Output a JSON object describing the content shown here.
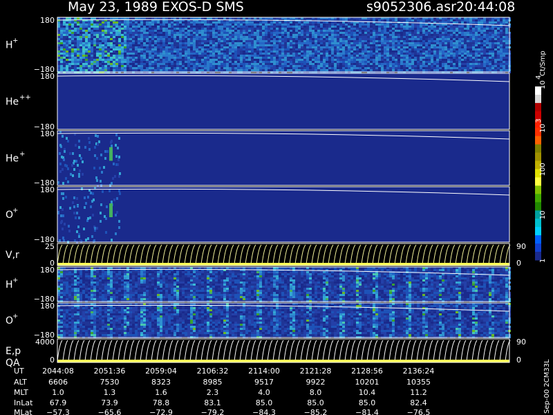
{
  "header": {
    "title": "May 23, 1989   EXOS-D SMS",
    "file": "s9052306.asr",
    "time": "20:44:08"
  },
  "side": {
    "cbar_label": "Ct/Smp",
    "version": "Sep-00  2CM33L"
  },
  "colors": {
    "background": "#000000",
    "panel_bg": "#1a2a8c",
    "trace": "#ffffff",
    "velocity_band": "#f2f29a",
    "axis_band": "#ffff55"
  },
  "chart_data": {
    "type": "heatmap",
    "panels": [
      {
        "ion": "H",
        "charge": "+",
        "ymax": "180",
        "ymin": "−180",
        "activity": "high"
      },
      {
        "ion": "He",
        "charge": "++",
        "ymax": "180",
        "ymin": "−180",
        "activity": "low"
      },
      {
        "ion": "He",
        "charge": "+",
        "ymax": "180",
        "ymin": "−180",
        "activity": "burst"
      },
      {
        "ion": "O",
        "charge": "+",
        "ymax": "180",
        "ymin": "−180",
        "activity": "burst"
      },
      {
        "ion": "V,r",
        "charge": "",
        "ymax": "25",
        "ymin": "0",
        "right_max": "90",
        "right_min": "0",
        "activity": "line"
      },
      {
        "ion": "H",
        "charge": "+",
        "ymax": "180",
        "ymin": "−180",
        "activity": "striped"
      },
      {
        "ion": "O",
        "charge": "+",
        "ymax": "180",
        "ymin": "−180",
        "activity": "striped"
      },
      {
        "ion": "E,p",
        "charge": "",
        "sub": "QA",
        "ymax": "4000",
        "ymin": "0",
        "right_max": "90",
        "right_min": "0",
        "activity": "line"
      }
    ],
    "colorbar": {
      "ticks": [
        {
          "label": "10",
          "exp": "4",
          "value": 10000
        },
        {
          "label": "10",
          "exp": "3",
          "value": 1000
        },
        {
          "label": "100",
          "exp": "",
          "value": 100
        },
        {
          "label": "10",
          "exp": "",
          "value": 10
        },
        {
          "label": "1",
          "exp": "",
          "value": 1
        }
      ],
      "colors": [
        "#ffffff",
        "#d8d8d8",
        "#b00000",
        "#cc0000",
        "#ff2000",
        "#ff3000",
        "#ff6000",
        "#808000",
        "#a09000",
        "#c0b000",
        "#e0e000",
        "#ffff40",
        "#80c000",
        "#40a800",
        "#208800",
        "#00a0a0",
        "#00c0d0",
        "#00d0ff",
        "#0060ff",
        "#1040d0",
        "#1a2a8c"
      ]
    },
    "footer": {
      "row_labels": [
        "UT",
        "ALT",
        "MLT",
        "InLat",
        "MLat"
      ],
      "columns": [
        {
          "UT": "2044:08",
          "ALT": "6606",
          "MLT": "1.0",
          "InLat": "67.9",
          "MLat": "−57.3"
        },
        {
          "UT": "2051:36",
          "ALT": "7530",
          "MLT": "1.3",
          "InLat": "73.9",
          "MLat": "−65.6"
        },
        {
          "UT": "2059:04",
          "ALT": "8323",
          "MLT": "1.6",
          "InLat": "78.8",
          "MLat": "−72.9"
        },
        {
          "UT": "2106:32",
          "ALT": "8985",
          "MLT": "2.3",
          "InLat": "83.1",
          "MLat": "−79.2"
        },
        {
          "UT": "2114:00",
          "ALT": "9517",
          "MLT": "4.0",
          "InLat": "85.0",
          "MLat": "−84.3"
        },
        {
          "UT": "2121:28",
          "ALT": "9922",
          "MLT": "8.0",
          "InLat": "85.0",
          "MLat": "−85.2"
        },
        {
          "UT": "2128:56",
          "ALT": "10201",
          "MLT": "10.4",
          "InLat": "85.0",
          "MLat": "−81.4"
        },
        {
          "UT": "2136:24",
          "ALT": "10355",
          "MLT": "11.2",
          "InLat": "82.4",
          "MLat": "−76.5"
        }
      ]
    }
  }
}
